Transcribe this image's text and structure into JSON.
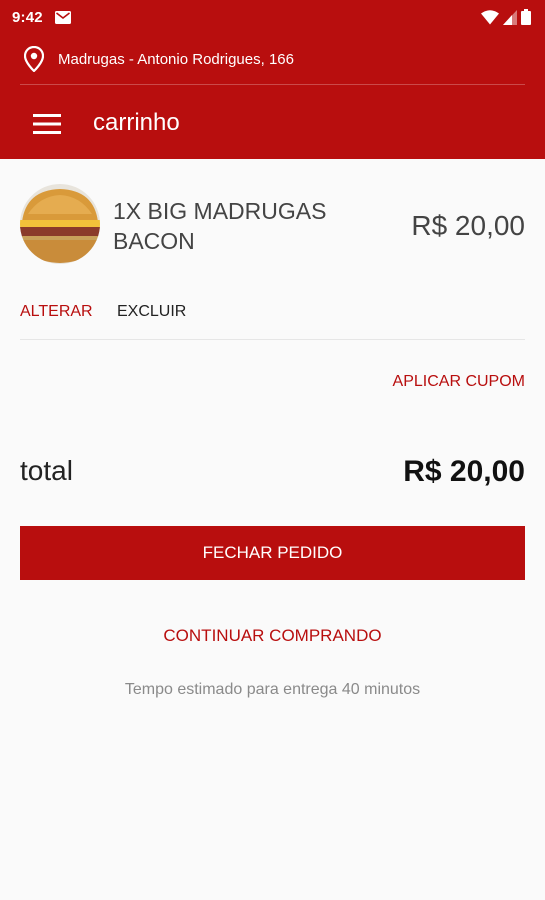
{
  "status_bar": {
    "time": "9:42",
    "icons": [
      "mail-icon",
      "wifi-icon",
      "signal-icon",
      "battery-icon"
    ]
  },
  "header": {
    "location": "Madrugas - Antonio Rodrigues, 166",
    "title": "carrinho",
    "color": "#b80e0e"
  },
  "cart": {
    "items": [
      {
        "name": "1x BIG MADRUGAS BACON",
        "price": "R$ 20,00",
        "image": "burger-photo"
      }
    ],
    "edit_label": "ALTERAR",
    "delete_label": "EXCLUIR",
    "coupon_label": "APLICAR CUPOM",
    "total_label": "total",
    "total_value": "R$ 20,00",
    "checkout_label": "FECHAR PEDIDO",
    "continue_label": "CONTINUAR COMPRANDO",
    "delivery_estimate": "Tempo estimado para entrega 40 minutos"
  }
}
